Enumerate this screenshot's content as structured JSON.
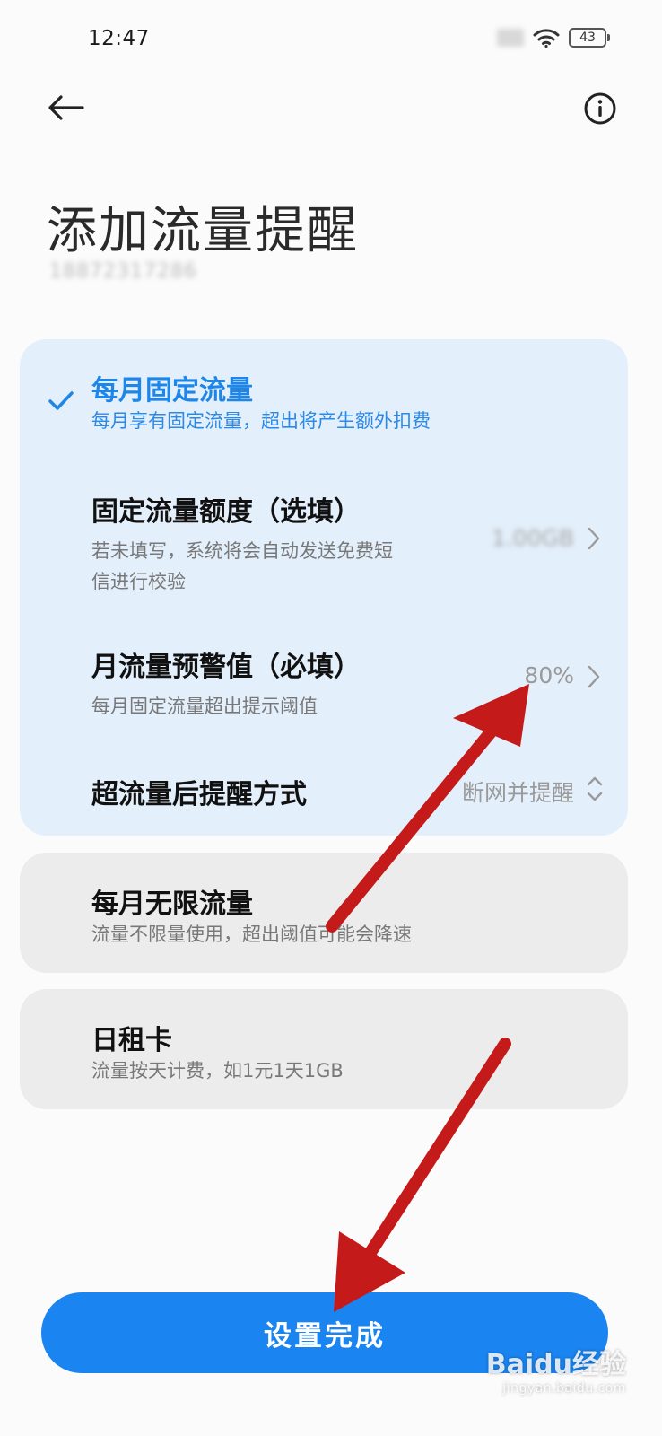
{
  "status_bar": {
    "time": "12:47",
    "battery": "43"
  },
  "header": {
    "title": "添加流量提醒",
    "phone_number": "18872317286"
  },
  "options": {
    "monthly_fixed": {
      "title": "每月固定流量",
      "subtitle": "每月享有固定流量，超出将产生额外扣费",
      "selected": true
    },
    "fixed_quota": {
      "title": "固定流量额度（选填）",
      "subtitle_line1": "若未填写，系统将会自动发送免费短",
      "subtitle_line2": "信进行校验",
      "value": "1.00GB"
    },
    "warning_threshold": {
      "title": "月流量预警值（必填）",
      "subtitle": "每月固定流量超出提示阈值",
      "value": "80%"
    },
    "over_limit_action": {
      "title": "超流量后提醒方式",
      "value": "断网并提醒"
    },
    "monthly_unlimited": {
      "title": "每月无限流量",
      "subtitle": "流量不限量使用，超出阈值可能会降速"
    },
    "daily_card": {
      "title": "日租卡",
      "subtitle": "流量按天计费，如1元1天1GB"
    }
  },
  "done_button": {
    "label": "设置完成"
  },
  "watermark": {
    "brand": "Baidu经验",
    "url": "jingyan.baidu.com"
  },
  "colors": {
    "accent": "#1a84f0",
    "selected_card": "#e3effb",
    "plain_card": "#ececec",
    "arrow": "#c41a1a"
  }
}
